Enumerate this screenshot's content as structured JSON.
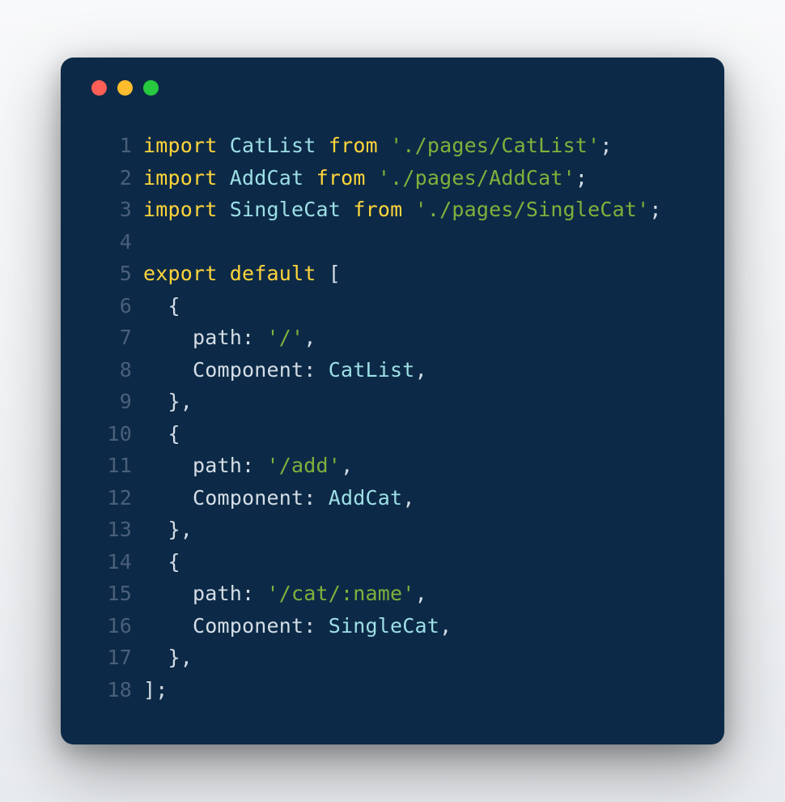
{
  "window": {
    "traffic_lights": [
      "red",
      "yellow",
      "green"
    ]
  },
  "code": {
    "lines": [
      {
        "n": "1",
        "tokens": [
          {
            "t": "kw",
            "v": "import"
          },
          {
            "t": "punct",
            "v": " "
          },
          {
            "t": "id",
            "v": "CatList"
          },
          {
            "t": "punct",
            "v": " "
          },
          {
            "t": "kw",
            "v": "from"
          },
          {
            "t": "punct",
            "v": " "
          },
          {
            "t": "str",
            "v": "'./pages/CatList'"
          },
          {
            "t": "punct",
            "v": ";"
          }
        ]
      },
      {
        "n": "2",
        "tokens": [
          {
            "t": "kw",
            "v": "import"
          },
          {
            "t": "punct",
            "v": " "
          },
          {
            "t": "id",
            "v": "AddCat"
          },
          {
            "t": "punct",
            "v": " "
          },
          {
            "t": "kw",
            "v": "from"
          },
          {
            "t": "punct",
            "v": " "
          },
          {
            "t": "str",
            "v": "'./pages/AddCat'"
          },
          {
            "t": "punct",
            "v": ";"
          }
        ]
      },
      {
        "n": "3",
        "tokens": [
          {
            "t": "kw",
            "v": "import"
          },
          {
            "t": "punct",
            "v": " "
          },
          {
            "t": "id",
            "v": "SingleCat"
          },
          {
            "t": "punct",
            "v": " "
          },
          {
            "t": "kw",
            "v": "from"
          },
          {
            "t": "punct",
            "v": " "
          },
          {
            "t": "str",
            "v": "'./pages/SingleCat'"
          },
          {
            "t": "punct",
            "v": ";"
          }
        ]
      },
      {
        "n": "4",
        "tokens": []
      },
      {
        "n": "5",
        "tokens": [
          {
            "t": "kw",
            "v": "export"
          },
          {
            "t": "punct",
            "v": " "
          },
          {
            "t": "kw",
            "v": "default"
          },
          {
            "t": "punct",
            "v": " ["
          }
        ]
      },
      {
        "n": "6",
        "tokens": [
          {
            "t": "punct",
            "v": "  {"
          }
        ]
      },
      {
        "n": "7",
        "tokens": [
          {
            "t": "punct",
            "v": "    "
          },
          {
            "t": "prop",
            "v": "path"
          },
          {
            "t": "punct",
            "v": ": "
          },
          {
            "t": "str",
            "v": "'/'"
          },
          {
            "t": "punct",
            "v": ","
          }
        ]
      },
      {
        "n": "8",
        "tokens": [
          {
            "t": "punct",
            "v": "    "
          },
          {
            "t": "prop",
            "v": "Component"
          },
          {
            "t": "punct",
            "v": ": "
          },
          {
            "t": "id",
            "v": "CatList"
          },
          {
            "t": "punct",
            "v": ","
          }
        ]
      },
      {
        "n": "9",
        "tokens": [
          {
            "t": "punct",
            "v": "  },"
          }
        ]
      },
      {
        "n": "10",
        "tokens": [
          {
            "t": "punct",
            "v": "  {"
          }
        ]
      },
      {
        "n": "11",
        "tokens": [
          {
            "t": "punct",
            "v": "    "
          },
          {
            "t": "prop",
            "v": "path"
          },
          {
            "t": "punct",
            "v": ": "
          },
          {
            "t": "str",
            "v": "'/add'"
          },
          {
            "t": "punct",
            "v": ","
          }
        ]
      },
      {
        "n": "12",
        "tokens": [
          {
            "t": "punct",
            "v": "    "
          },
          {
            "t": "prop",
            "v": "Component"
          },
          {
            "t": "punct",
            "v": ": "
          },
          {
            "t": "id",
            "v": "AddCat"
          },
          {
            "t": "punct",
            "v": ","
          }
        ]
      },
      {
        "n": "13",
        "tokens": [
          {
            "t": "punct",
            "v": "  },"
          }
        ]
      },
      {
        "n": "14",
        "tokens": [
          {
            "t": "punct",
            "v": "  {"
          }
        ]
      },
      {
        "n": "15",
        "tokens": [
          {
            "t": "punct",
            "v": "    "
          },
          {
            "t": "prop",
            "v": "path"
          },
          {
            "t": "punct",
            "v": ": "
          },
          {
            "t": "str",
            "v": "'/cat/:name'"
          },
          {
            "t": "punct",
            "v": ","
          }
        ]
      },
      {
        "n": "16",
        "tokens": [
          {
            "t": "punct",
            "v": "    "
          },
          {
            "t": "prop",
            "v": "Component"
          },
          {
            "t": "punct",
            "v": ": "
          },
          {
            "t": "id",
            "v": "SingleCat"
          },
          {
            "t": "punct",
            "v": ","
          }
        ]
      },
      {
        "n": "17",
        "tokens": [
          {
            "t": "punct",
            "v": "  },"
          }
        ]
      },
      {
        "n": "18",
        "tokens": [
          {
            "t": "punct",
            "v": "];"
          }
        ]
      }
    ]
  }
}
